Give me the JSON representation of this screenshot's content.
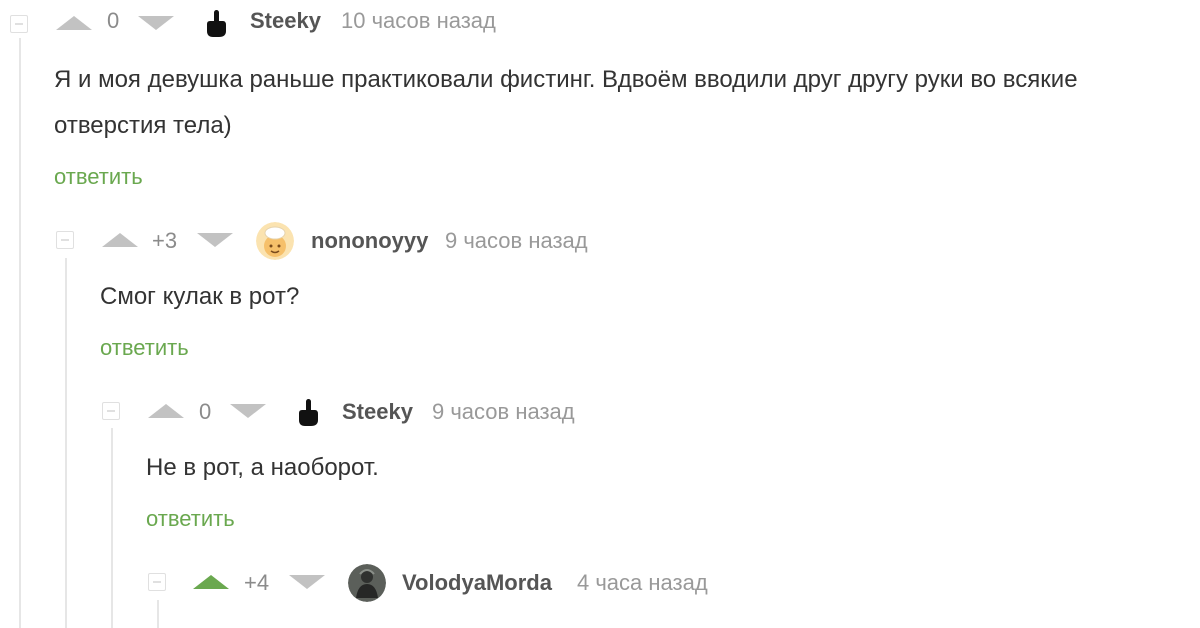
{
  "comments": [
    {
      "score": "0",
      "author": "Steeky",
      "time": "10 часов назад",
      "text": "Я и моя девушка раньше практиковали фистинг. Вдвоём вводили друг другу руки во всякие отверстия тела)",
      "reply": "ответить",
      "avatar_icon": "middle-finger-icon",
      "vote_state": "none"
    },
    {
      "score": "+3",
      "author": "nononoyyy",
      "time": "9 часов назад",
      "text": "Смог кулак в рот?",
      "reply": "ответить",
      "avatar_icon": "chef-avatar-icon",
      "vote_state": "none"
    },
    {
      "score": "0",
      "author": "Steeky",
      "time": "9 часов назад",
      "text": "Не в рот, а наоборот.",
      "reply": "ответить",
      "avatar_icon": "middle-finger-icon",
      "vote_state": "none"
    },
    {
      "score": "+4",
      "author": "VolodyaMorda",
      "time": "4 часа назад",
      "avatar_icon": "photo-avatar-icon",
      "vote_state": "upvoted"
    }
  ],
  "colors": {
    "upvote_active": "#6aa84f",
    "arrow_inactive": "#c2c2c2",
    "reply": "#6aa84f",
    "thread_line": "#e6e6e6"
  }
}
